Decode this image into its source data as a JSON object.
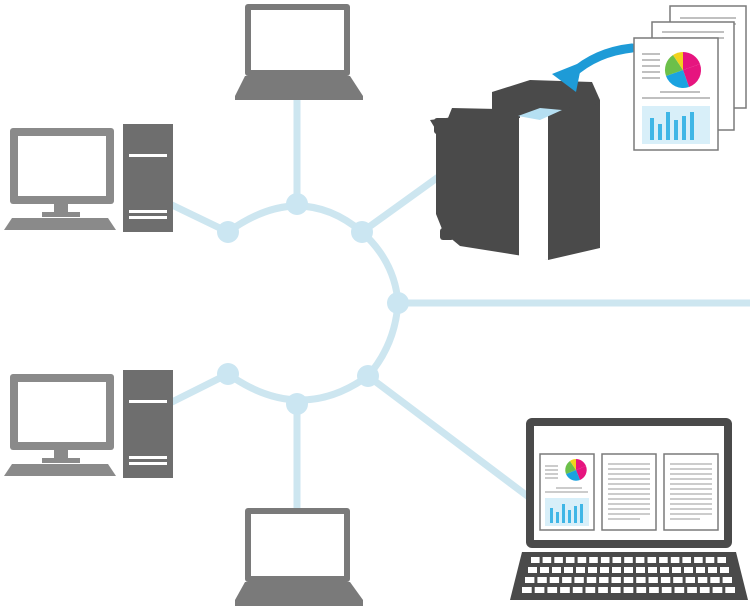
{
  "diagram": {
    "type": "network-topology",
    "colors": {
      "network_line": "#cde6f0",
      "network_node": "#cbe6f2",
      "device_dark": "#4a4a4a",
      "device_mid": "#7a7a7a",
      "device_light": "#9a9a9a",
      "screen": "#ffffff",
      "arrow": "#1e9bd7",
      "bar_chart": "#3fb6e6",
      "pie_magenta": "#e6157f",
      "pie_yellow": "#f2d21c",
      "pie_green": "#6cc04a",
      "pie_blue": "#1aa3e0",
      "printer_panel": "#b5dff2"
    },
    "devices": [
      {
        "kind": "laptop",
        "icon": "laptop-icon",
        "position": "top"
      },
      {
        "kind": "desktop",
        "icon": "desktop-computer-icon",
        "position": "upper-left"
      },
      {
        "kind": "desktop",
        "icon": "desktop-computer-icon",
        "position": "lower-left"
      },
      {
        "kind": "laptop",
        "icon": "laptop-icon",
        "position": "bottom"
      },
      {
        "kind": "multifunction-printer",
        "icon": "printer-icon",
        "position": "upper-right"
      },
      {
        "kind": "laptop",
        "icon": "laptop-with-documents-icon",
        "position": "lower-right"
      }
    ],
    "documents": {
      "icon": "document-stack-icon",
      "count": 3
    },
    "network": {
      "icon": "network-ring-icon",
      "nodes": 7
    }
  }
}
